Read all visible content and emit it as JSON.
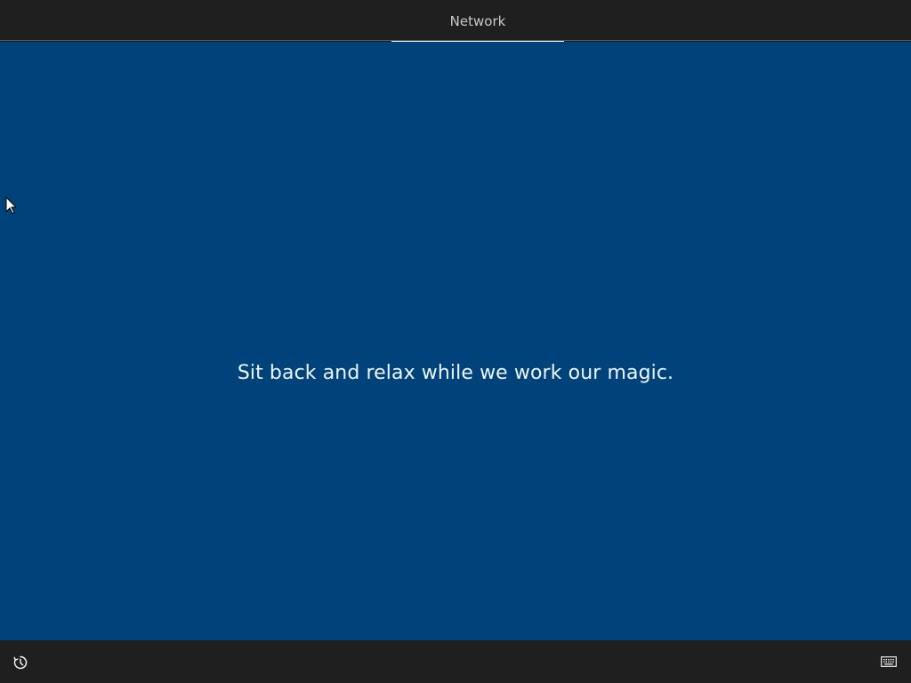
{
  "header": {
    "active_step": "Network"
  },
  "main": {
    "message": "Sit back and relax while we work our magic."
  },
  "footer": {
    "left_icon": "ease-of-access-icon",
    "right_icon": "keyboard-icon"
  },
  "colors": {
    "background": "#00437a",
    "chrome": "#1f1f1f",
    "text": "#eef4fb",
    "step_text": "#c9c9c9",
    "step_indicator": "#f2f2f2"
  }
}
